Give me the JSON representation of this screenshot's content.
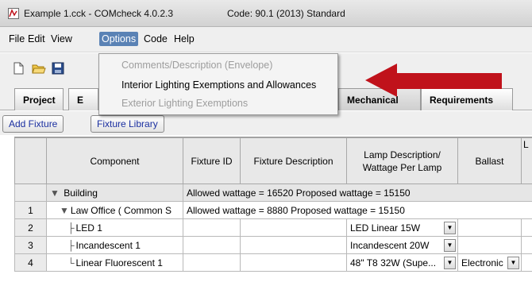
{
  "window": {
    "title": "Example 1.cck - COMcheck 4.0.2.3",
    "code": "Code: 90.1 (2013) Standard"
  },
  "menubar": {
    "items": [
      {
        "label": "File"
      },
      {
        "label": "Edit"
      },
      {
        "label": "View"
      },
      {
        "label": "Options"
      },
      {
        "label": "Code"
      },
      {
        "label": "Help"
      }
    ],
    "active": "Options"
  },
  "options_menu": {
    "items": [
      {
        "label": "Comments/Description (Envelope)",
        "enabled": false
      },
      {
        "label": "Interior Lighting Exemptions and Allowances",
        "enabled": true
      },
      {
        "label": "Exterior Lighting Exemptions",
        "enabled": false
      }
    ]
  },
  "tabs": [
    {
      "label": "Project"
    },
    {
      "label": "E"
    },
    {
      "label": "Mechanical"
    },
    {
      "label": "Requirements"
    }
  ],
  "subtoolbar": {
    "add_fixture": "Add Fixture",
    "fixture_library": "Fixture Library"
  },
  "table": {
    "headers": [
      "Component",
      "Fixture ID",
      "Fixture Description",
      "Lamp Description/ Wattage Per Lamp",
      "Ballast",
      "L"
    ],
    "group_building": {
      "component": "Building",
      "info": "Allowed wattage = 16520   Proposed wattage = 15150"
    },
    "rows": [
      {
        "num": "1",
        "component": "Law Office ( Common S",
        "info": "Allowed wattage = 8880   Proposed wattage = 15150"
      },
      {
        "num": "2",
        "component": "LED 1",
        "lamp": "LED Linear 15W",
        "ballast": ""
      },
      {
        "num": "3",
        "component": "Incandescent 1",
        "lamp": "Incandescent 20W",
        "ballast": ""
      },
      {
        "num": "4",
        "component": "Linear Fluorescent 1",
        "lamp": "48\" T8 32W (Supe...",
        "ballast": "Electronic"
      }
    ]
  },
  "colors": {
    "menu_highlight": "#5a82b5",
    "arrow": "#c0121b",
    "link_text": "#1a2fa0"
  }
}
